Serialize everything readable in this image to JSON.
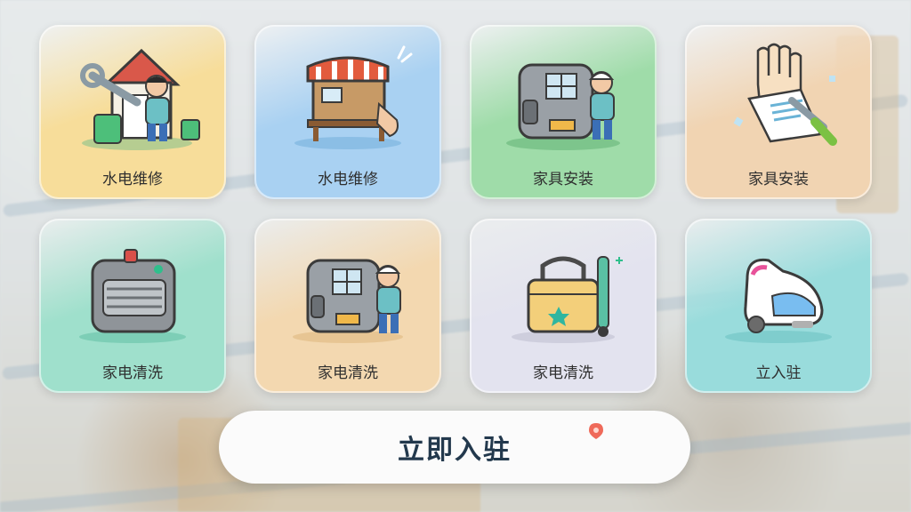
{
  "tiles": [
    {
      "label": "水电维修",
      "icon": "house-repair-worker-icon",
      "bg": "#f7dd9a"
    },
    {
      "label": "水电维修",
      "icon": "storefront-workbench-icon",
      "bg": "#a9d1f2"
    },
    {
      "label": "家具安装",
      "icon": "van-delivery-worker-icon",
      "bg": "#9fdca9"
    },
    {
      "label": "家具安装",
      "icon": "gloves-wrench-icon",
      "bg": "#f1d4b2"
    },
    {
      "label": "家电清洗",
      "icon": "washing-machine-icon",
      "bg": "#9fe0cc"
    },
    {
      "label": "家电清洗",
      "icon": "van-worker-icon",
      "bg": "#f3d8b0"
    },
    {
      "label": "家电清洗",
      "icon": "cleaning-toolbox-icon",
      "bg": "#e3e3ef"
    },
    {
      "label": "立入驻",
      "icon": "robot-vacuum-icon",
      "bg": "#99dcdc"
    }
  ],
  "cta": {
    "label": "立即入驻"
  }
}
